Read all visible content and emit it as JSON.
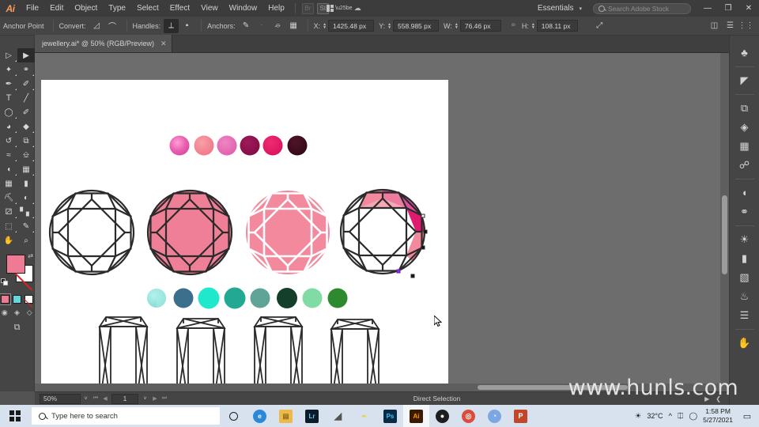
{
  "app": {
    "name": "Adobe Illustrator",
    "logo_text": "Ai"
  },
  "menubar": {
    "items": [
      "File",
      "Edit",
      "Object",
      "Type",
      "Select",
      "Effect",
      "View",
      "Window",
      "Help"
    ],
    "icons": [
      "bridge-icon",
      "stock-icon",
      "arrange-documents-icon",
      "chevron-down-icon",
      "sync-settings-icon"
    ],
    "workspace_label": "Essentials",
    "search_placeholder": "Search Adobe Stock",
    "window_buttons": {
      "minimize": "—",
      "maximize": "❐",
      "close": "✕"
    }
  },
  "controlbar": {
    "title": "Anchor Point",
    "convert_label": "Convert:",
    "handles_label": "Handles:",
    "anchors_label": "Anchors:",
    "fields": [
      {
        "label": "X:",
        "value": "1425.48 px"
      },
      {
        "label": "Y:",
        "value": "558.985 px"
      },
      {
        "label": "W:",
        "value": "76.46 px"
      },
      {
        "label": "H:",
        "value": "108.11 px"
      }
    ],
    "align_icon": "align-anchors-icon",
    "transform_icon": "transform-icon"
  },
  "tab": {
    "title": "jewellery.ai* @ 50% (RGB/Preview)",
    "close": "✕"
  },
  "toolbar": {
    "tools": [
      {
        "name": "selection-tool",
        "glyph": "▷"
      },
      {
        "name": "direct-selection-tool",
        "glyph": "▶",
        "selected": true
      },
      {
        "name": "magic-wand-tool",
        "glyph": "✨"
      },
      {
        "name": "lasso-tool",
        "glyph": "◔"
      },
      {
        "name": "pen-tool",
        "glyph": "✒"
      },
      {
        "name": "curvature-tool",
        "glyph": "✎"
      },
      {
        "name": "type-tool",
        "glyph": "T"
      },
      {
        "name": "line-segment-tool",
        "glyph": "╱"
      },
      {
        "name": "ellipse-tool",
        "glyph": "○"
      },
      {
        "name": "paintbrush-tool",
        "glyph": "✐"
      },
      {
        "name": "shaper-tool",
        "glyph": "◑"
      },
      {
        "name": "eraser-tool",
        "glyph": "◆"
      },
      {
        "name": "rotate-tool",
        "glyph": "↺"
      },
      {
        "name": "scale-tool",
        "glyph": "⧉"
      },
      {
        "name": "width-tool",
        "glyph": "≈"
      },
      {
        "name": "free-transform-tool",
        "glyph": "⌗"
      },
      {
        "name": "shape-builder-tool",
        "glyph": "◕"
      },
      {
        "name": "perspective-grid-tool",
        "glyph": "▦"
      },
      {
        "name": "mesh-tool",
        "glyph": "⊞"
      },
      {
        "name": "gradient-tool",
        "glyph": "■"
      },
      {
        "name": "eyedropper-tool",
        "glyph": "⚗"
      },
      {
        "name": "blend-tool",
        "glyph": "◐"
      },
      {
        "name": "symbol-sprayer-tool",
        "glyph": "❂"
      },
      {
        "name": "column-graph-tool",
        "glyph": "▐"
      },
      {
        "name": "artboard-tool",
        "glyph": "⬚"
      },
      {
        "name": "slice-tool",
        "glyph": "✂"
      },
      {
        "name": "hand-tool",
        "glyph": "✋"
      },
      {
        "name": "zoom-tool",
        "glyph": "⌕"
      }
    ],
    "fill_color": "#ee7b93",
    "stroke_color": "none",
    "color_modes": [
      "color-swatch",
      "gradient-swatch",
      "none-swatch"
    ],
    "draw_modes": [
      "draw-normal",
      "draw-behind",
      "draw-inside"
    ],
    "screen_mode": "change-screen-mode"
  },
  "rightdock": {
    "icons": [
      "properties-icon",
      "libraries-icon",
      "pathfinder-icon",
      "layers-icon",
      "artboards-icon",
      "asset-export-icon",
      "transparency-icon",
      "gradient-icon",
      "appearance-icon",
      "swatches-icon",
      "color-guide-icon",
      "brushes-icon",
      "align-icon",
      "symbols-icon"
    ]
  },
  "statusbar": {
    "zoom": "50%",
    "page": "1",
    "tool": "Direct Selection",
    "chevron": "˅"
  },
  "artwork": {
    "swatch_row_pink": [
      {
        "name": "pink-swatch-1",
        "color": "#e85fb0"
      },
      {
        "name": "pink-swatch-2",
        "color": "#f27d8e"
      },
      {
        "name": "pink-swatch-3",
        "color": "#e364ae"
      },
      {
        "name": "pink-swatch-4",
        "color": "#8d0f4d"
      },
      {
        "name": "pink-swatch-5",
        "color": "#e51a64"
      },
      {
        "name": "pink-swatch-6",
        "color": "#3d0a1c"
      }
    ],
    "swatch_row_teal": [
      {
        "name": "teal-swatch-1",
        "color": "#8fe3dd"
      },
      {
        "name": "teal-swatch-2",
        "color": "#3b6f8c"
      },
      {
        "name": "teal-swatch-3",
        "color": "#1fe8cd"
      },
      {
        "name": "teal-swatch-4",
        "color": "#23a894"
      },
      {
        "name": "teal-swatch-5",
        "color": "#5fa496"
      },
      {
        "name": "teal-swatch-6",
        "color": "#14402b"
      },
      {
        "name": "teal-swatch-7",
        "color": "#81dba4"
      },
      {
        "name": "teal-swatch-8",
        "color": "#2e8a2e"
      }
    ],
    "gems": [
      {
        "name": "gem-outline",
        "fill": "none",
        "stroke": "#2b2b2b"
      },
      {
        "name": "gem-pink-filled",
        "fill": "#ef7f96",
        "stroke": "#2b2b2b"
      },
      {
        "name": "gem-pink-white-facets",
        "fill": "#f2899c",
        "stroke": "#ffffff"
      },
      {
        "name": "gem-partial-colored",
        "fill": "none",
        "stroke": "#2b2b2b",
        "selected": true
      }
    ],
    "emerald_cuts": [
      {
        "name": "emerald-cut-1"
      },
      {
        "name": "emerald-cut-2"
      },
      {
        "name": "emerald-cut-3"
      },
      {
        "name": "emerald-cut-4"
      }
    ]
  },
  "watermark": {
    "text": "www.hunls.com"
  },
  "taskbar": {
    "search_placeholder": "Type here to search",
    "apps": [
      {
        "name": "taskbar-edge",
        "label": "e",
        "color": "#2b88d8"
      },
      {
        "name": "taskbar-file-explorer",
        "label": "▤",
        "color": "#ecb94a"
      },
      {
        "name": "taskbar-lightroom",
        "label": "Lr",
        "color": "#1c2d3f"
      },
      {
        "name": "taskbar-bird-app",
        "label": "◢",
        "color": "#6b6b6b"
      },
      {
        "name": "taskbar-paint",
        "label": "◓",
        "color": "#e6e06a"
      },
      {
        "name": "taskbar-photoshop",
        "label": "Ps",
        "color": "#1c3b5a"
      },
      {
        "name": "taskbar-illustrator",
        "label": "Ai",
        "color": "#4b2100",
        "active": true
      },
      {
        "name": "taskbar-dark-globe",
        "label": "●",
        "color": "#2a2a2a"
      },
      {
        "name": "taskbar-chrome",
        "label": "◎",
        "color": "#dd4b3e"
      },
      {
        "name": "taskbar-browser",
        "label": "◔",
        "color": "#6b9fe0"
      },
      {
        "name": "taskbar-powerpoint",
        "label": "P",
        "color": "#c4462a"
      }
    ],
    "tray": {
      "weather": "32°C",
      "time": "1:58 PM",
      "date": "5/27/2021",
      "icons": [
        "chevron-up-icon",
        "onedrive-icon",
        "wifi-icon"
      ],
      "action_center": "▭"
    }
  }
}
